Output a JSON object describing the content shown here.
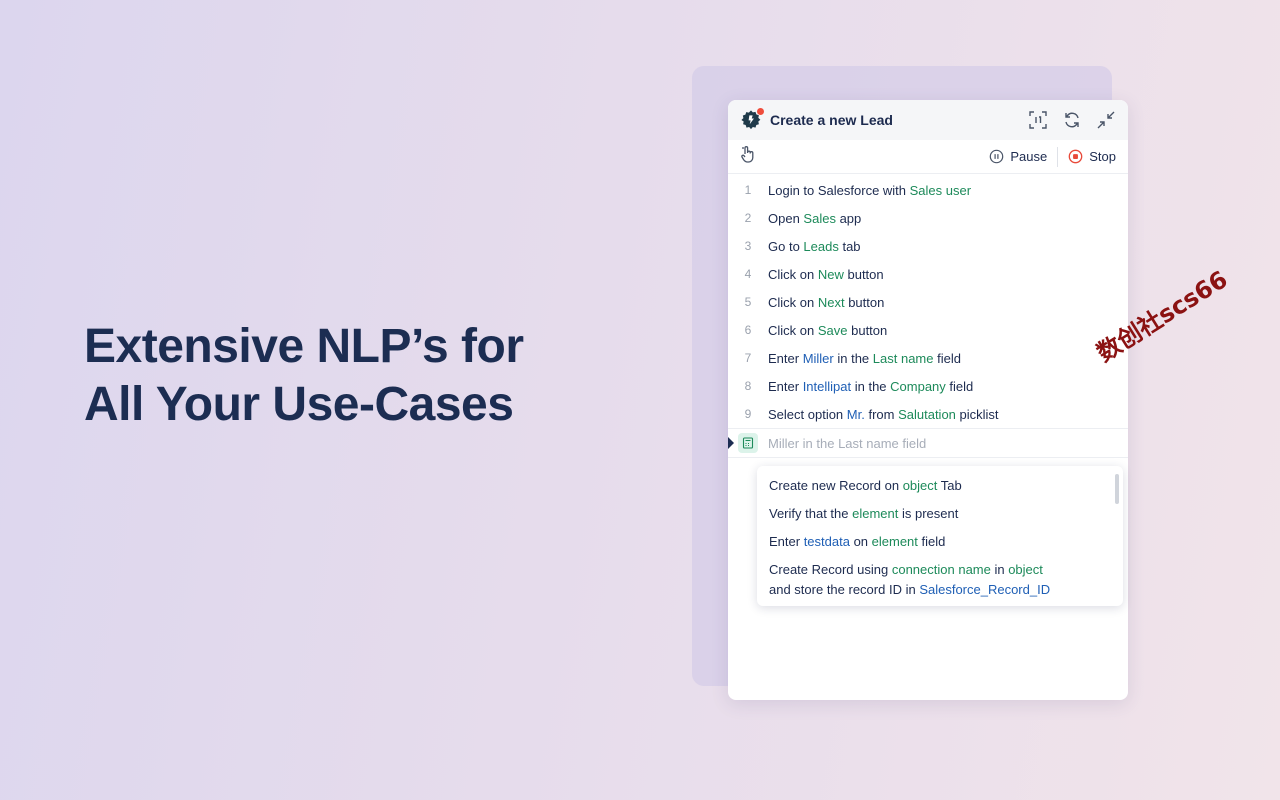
{
  "hero": {
    "line1": "Extensive NLP’s for",
    "line2": "All Your Use-Cases"
  },
  "panel": {
    "title": "Create a new Lead",
    "header_icons": [
      "scan-icon",
      "refresh-icon",
      "collapse-icon"
    ],
    "toolbar": {
      "pause_label": "Pause",
      "stop_label": "Stop",
      "accent": "#e84a3a"
    },
    "steps": [
      {
        "num": "1",
        "parts": [
          {
            "t": "Login to Salesforce with "
          },
          {
            "t": "Sales user",
            "c": "g"
          }
        ]
      },
      {
        "num": "2",
        "parts": [
          {
            "t": "Open "
          },
          {
            "t": "Sales",
            "c": "g"
          },
          {
            "t": " app"
          }
        ]
      },
      {
        "num": "3",
        "parts": [
          {
            "t": "Go to "
          },
          {
            "t": "Leads",
            "c": "g"
          },
          {
            "t": " tab"
          }
        ]
      },
      {
        "num": "4",
        "parts": [
          {
            "t": "Click on "
          },
          {
            "t": "New",
            "c": "g"
          },
          {
            "t": " button"
          }
        ]
      },
      {
        "num": "5",
        "parts": [
          {
            "t": "Click on "
          },
          {
            "t": "Next",
            "c": "g"
          },
          {
            "t": " button"
          }
        ]
      },
      {
        "num": "6",
        "parts": [
          {
            "t": "Click on "
          },
          {
            "t": "Save",
            "c": "g"
          },
          {
            "t": " button"
          }
        ]
      },
      {
        "num": "7",
        "parts": [
          {
            "t": "Enter "
          },
          {
            "t": "Miller",
            "c": "b"
          },
          {
            "t": " in the "
          },
          {
            "t": "Last name",
            "c": "g"
          },
          {
            "t": " field"
          }
        ]
      },
      {
        "num": "8",
        "parts": [
          {
            "t": "Enter "
          },
          {
            "t": "Intellipat",
            "c": "b"
          },
          {
            "t": " in the "
          },
          {
            "t": "Company",
            "c": "g"
          },
          {
            "t": " field"
          }
        ]
      },
      {
        "num": "9",
        "parts": [
          {
            "t": "Select option "
          },
          {
            "t": "Mr.",
            "c": "b"
          },
          {
            "t": " from "
          },
          {
            "t": "Salutation",
            "c": "g"
          },
          {
            "t": " picklist"
          }
        ]
      }
    ],
    "input": {
      "placeholder": "Miller in the Last name field"
    },
    "suggestions": [
      {
        "lines": [
          [
            {
              "t": "Create new Record on "
            },
            {
              "t": "object",
              "c": "g"
            },
            {
              "t": " Tab"
            }
          ]
        ]
      },
      {
        "lines": [
          [
            {
              "t": "Verify that the "
            },
            {
              "t": "element",
              "c": "g"
            },
            {
              "t": " is present"
            }
          ]
        ]
      },
      {
        "lines": [
          [
            {
              "t": "Enter "
            },
            {
              "t": "testdata",
              "c": "b"
            },
            {
              "t": " on "
            },
            {
              "t": "element",
              "c": "g"
            },
            {
              "t": " field"
            }
          ]
        ]
      },
      {
        "lines": [
          [
            {
              "t": "Create Record using "
            },
            {
              "t": "connection name",
              "c": "g"
            },
            {
              "t": " in "
            },
            {
              "t": "object",
              "c": "g"
            }
          ],
          [
            {
              "t": "and store the record ID in "
            },
            {
              "t": "Salesforce_Record_ID",
              "c": "b"
            }
          ]
        ]
      }
    ]
  },
  "watermark": "数创社scs66",
  "colors": {
    "green_token": "#1d8a5a",
    "blue_token": "#1f5fb5",
    "title": "#1c2d52"
  }
}
